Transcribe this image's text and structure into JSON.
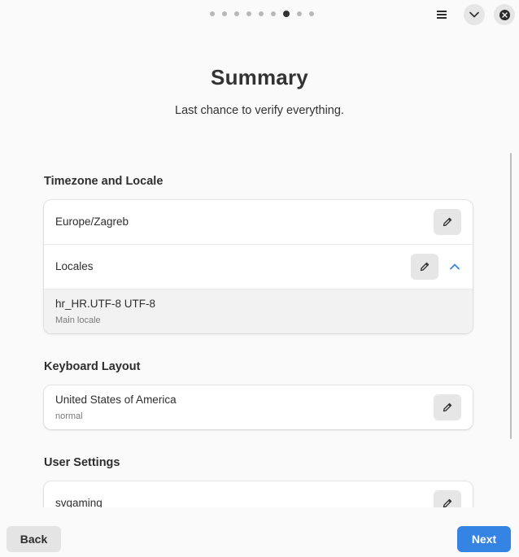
{
  "header": {
    "pages": 9,
    "active_page": 7,
    "icons": [
      "menu-icon",
      "chevron-down-icon",
      "close-icon"
    ]
  },
  "title": "Summary",
  "subtitle": "Last chance to verify everything.",
  "sections": {
    "timezone": {
      "title": "Timezone and Locale",
      "timezone_value": "Europe/Zagreb",
      "locales_label": "Locales",
      "locale_value": "hr_HR.UTF-8 UTF-8",
      "locale_sub": "Main locale"
    },
    "keyboard": {
      "title": "Keyboard Layout",
      "layout_value": "United States of America",
      "layout_sub": "normal"
    },
    "user": {
      "title": "User Settings",
      "username": "svgaming"
    }
  },
  "footer": {
    "back_label": "Back",
    "next_label": "Next"
  },
  "colors": {
    "accent": "#3584e4",
    "background": "#fafafa",
    "card": "#ffffff",
    "button": "#e6e6e6"
  }
}
